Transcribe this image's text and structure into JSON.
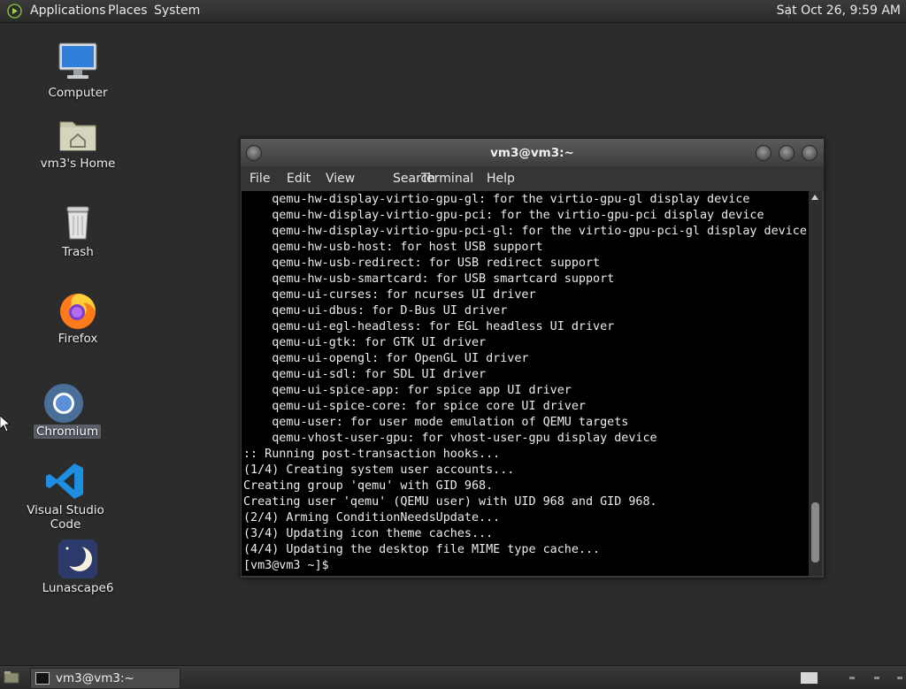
{
  "top_panel": {
    "menus": [
      "Applications",
      "Places",
      "System"
    ],
    "clock": "Sat Oct 26,  9:59 AM"
  },
  "desktop_icons": [
    {
      "label": "Computer",
      "icon": "computer-icon"
    },
    {
      "label": "vm3's Home",
      "icon": "home-folder-icon"
    },
    {
      "label": "Trash",
      "icon": "trash-icon"
    },
    {
      "label": "Firefox",
      "icon": "firefox-icon"
    },
    {
      "label": "Chromium",
      "icon": "chromium-icon",
      "selected": true
    },
    {
      "label": "Visual Studio Code",
      "icon": "vscode-icon"
    },
    {
      "label": "Lunascape6",
      "icon": "lunascape-icon"
    }
  ],
  "terminal": {
    "title": "vm3@vm3:~",
    "menu": [
      "File",
      "Edit",
      "View",
      "Search",
      "Terminal",
      "Help"
    ],
    "lines": [
      "    qemu-hw-display-virtio-gpu-gl: for the virtio-gpu-gl display device",
      "    qemu-hw-display-virtio-gpu-pci: for the virtio-gpu-pci display device",
      "    qemu-hw-display-virtio-gpu-pci-gl: for the virtio-gpu-pci-gl display device",
      "    qemu-hw-usb-host: for host USB support",
      "    qemu-hw-usb-redirect: for USB redirect support",
      "    qemu-hw-usb-smartcard: for USB smartcard support",
      "    qemu-ui-curses: for ncurses UI driver",
      "    qemu-ui-dbus: for D-Bus UI driver",
      "    qemu-ui-egl-headless: for EGL headless UI driver",
      "    qemu-ui-gtk: for GTK UI driver",
      "    qemu-ui-opengl: for OpenGL UI driver",
      "    qemu-ui-sdl: for SDL UI driver",
      "    qemu-ui-spice-app: for spice app UI driver",
      "    qemu-ui-spice-core: for spice core UI driver",
      "    qemu-user: for user mode emulation of QEMU targets",
      "    qemu-vhost-user-gpu: for vhost-user-gpu display device",
      ":: Running post-transaction hooks...",
      "(1/4) Creating system user accounts...",
      "Creating group 'qemu' with GID 968.",
      "Creating user 'qemu' (QEMU user) with UID 968 and GID 968.",
      "(2/4) Arming ConditionNeedsUpdate...",
      "(3/4) Updating icon theme caches...",
      "(4/4) Updating the desktop file MIME type cache...",
      "[vm3@vm3 ~]$ "
    ]
  },
  "taskbar": {
    "window_button": "vm3@vm3:~"
  },
  "colors": {
    "desktop_bg": "#2c2c2c",
    "terminal_bg": "#000000",
    "panel_bg": "#2f2f2f"
  }
}
